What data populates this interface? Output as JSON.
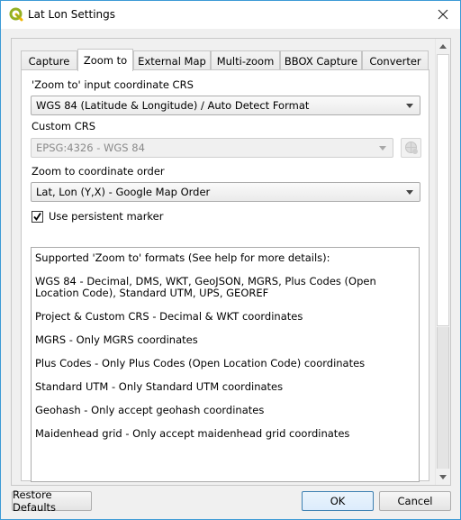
{
  "window": {
    "title": "Lat Lon Settings",
    "icon": "qgis-logo-icon",
    "close_icon": "close-icon"
  },
  "tabs": [
    {
      "label": "Capture",
      "active": false
    },
    {
      "label": "Zoom to",
      "active": true
    },
    {
      "label": "External Map",
      "active": false
    },
    {
      "label": "Multi-zoom",
      "active": false
    },
    {
      "label": "BBOX Capture",
      "active": false
    },
    {
      "label": "Converter",
      "active": false
    }
  ],
  "zoom_to": {
    "input_crs_label": "'Zoom to' input coordinate CRS",
    "input_crs_value": "WGS 84 (Latitude & Longitude) / Auto Detect Format",
    "custom_crs_label": "Custom CRS",
    "custom_crs_value": "EPSG:4326 - WGS 84",
    "custom_crs_enabled": false,
    "coord_order_label": "Zoom to coordinate order",
    "coord_order_value": "Lat, Lon (Y,X) - Google Map Order",
    "persistent_marker_label": "Use persistent marker",
    "persistent_marker_checked": true,
    "formats_text": [
      "Supported 'Zoom to' formats (See help for more details):",
      "WGS 84 - Decimal, DMS, WKT, GeoJSON, MGRS, Plus Codes (Open Location Code), Standard UTM, UPS, GEOREF",
      "Project & Custom CRS - Decimal & WKT coordinates",
      "MGRS - Only MGRS coordinates",
      "Plus Codes - Only Plus Codes (Open Location Code) coordinates",
      "Standard UTM - Only Standard UTM coordinates",
      "Geohash - Only accept geohash coordinates",
      "Maidenhead grid - Only accept maidenhead grid coordinates"
    ]
  },
  "buttons": {
    "restore_defaults": "Restore Defaults",
    "ok": "OK",
    "cancel": "Cancel"
  },
  "colors": {
    "window_border": "#3c9ad6",
    "default_button_border": "#3c7fb1"
  }
}
